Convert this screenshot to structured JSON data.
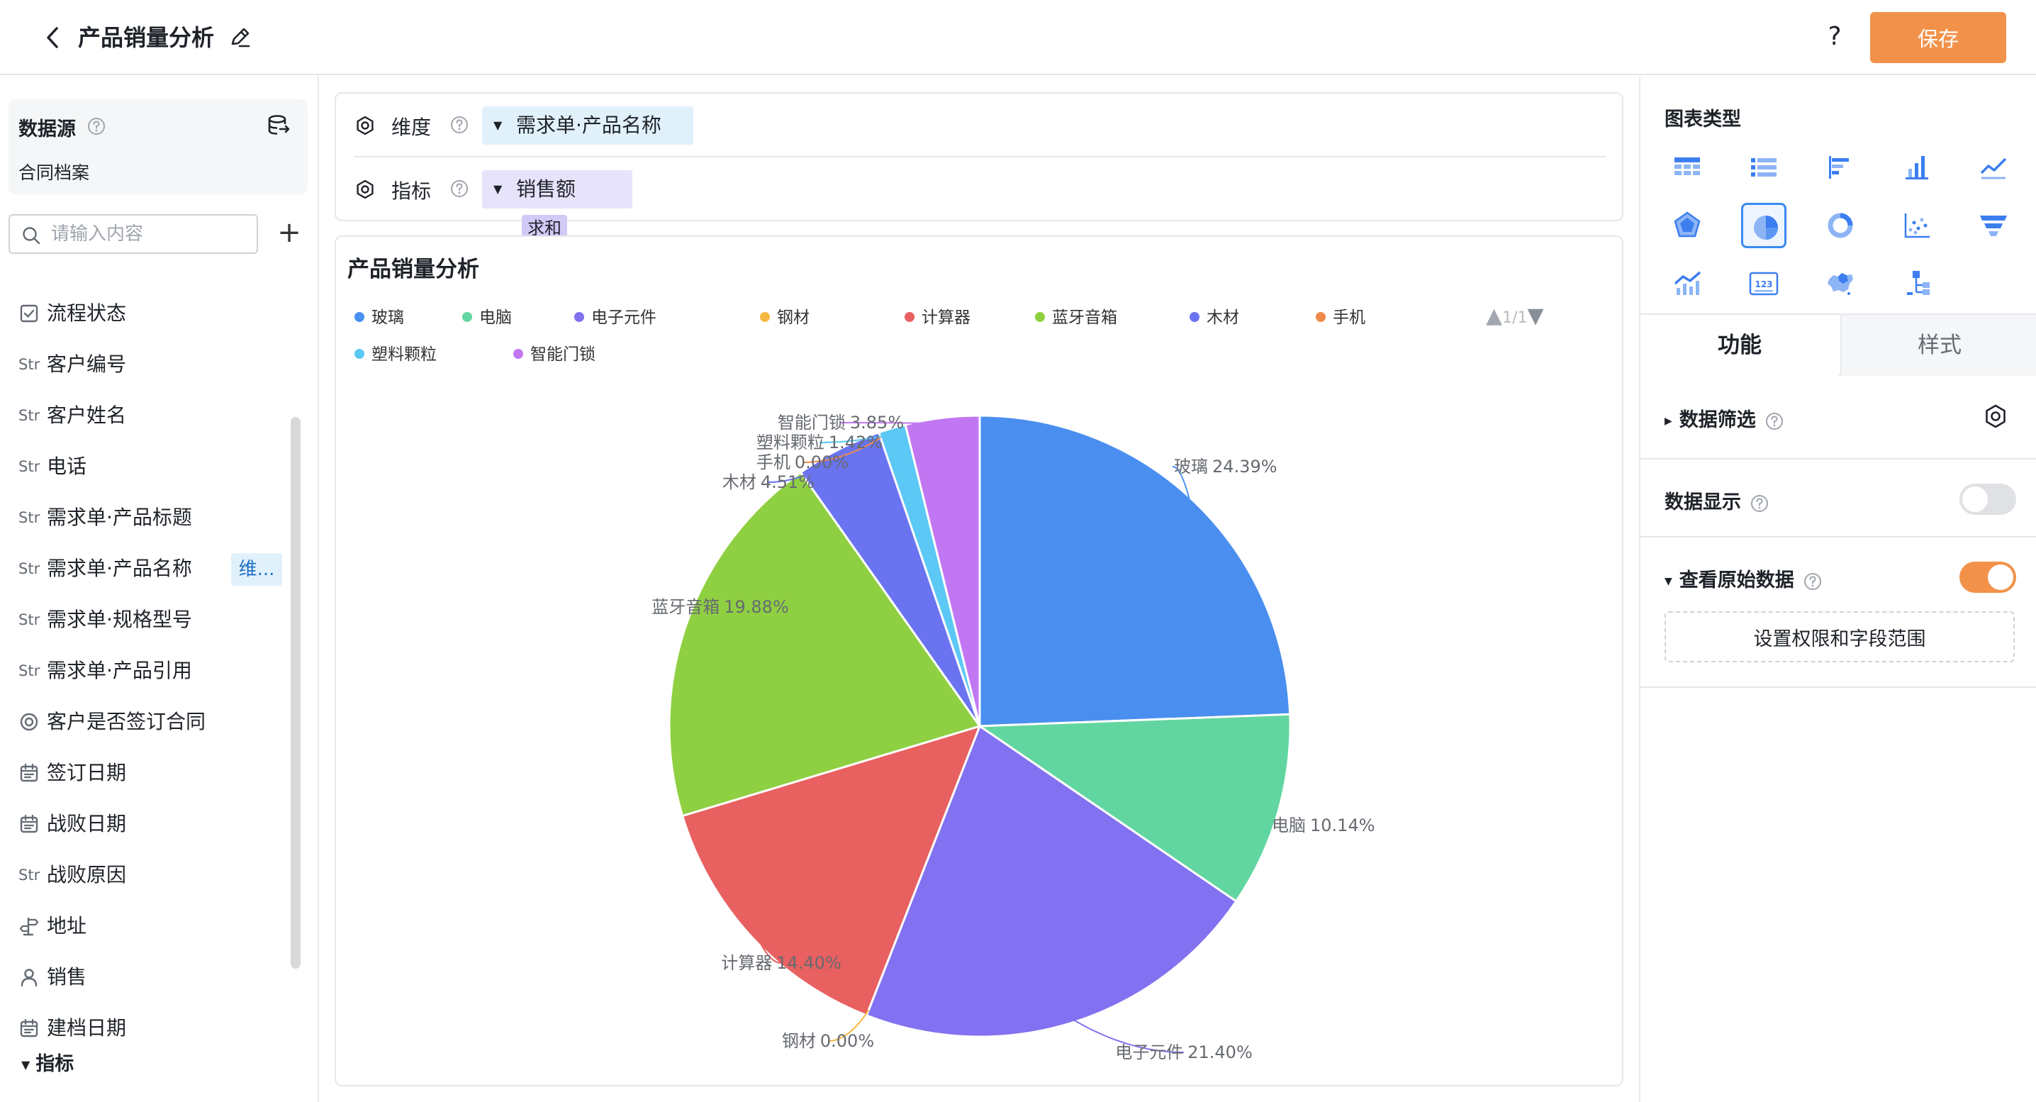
{
  "header": {
    "title": "产品销量分析",
    "help": "?",
    "save_label": "保存"
  },
  "datasource": {
    "label": "数据源",
    "name": "合同档案"
  },
  "search": {
    "placeholder": "请输入内容",
    "value": ""
  },
  "add": "+",
  "fields": [
    {
      "type": "check",
      "badge": "",
      "label": "流程状态"
    },
    {
      "type": "str",
      "badge": "Str",
      "label": "客户编号"
    },
    {
      "type": "str",
      "badge": "Str",
      "label": "客户姓名"
    },
    {
      "type": "str",
      "badge": "Str",
      "label": "电话"
    },
    {
      "type": "str",
      "badge": "Str",
      "label": "需求单·产品标题"
    },
    {
      "type": "str",
      "badge": "Str",
      "label": "需求单·产品名称",
      "tag": "维..."
    },
    {
      "type": "str",
      "badge": "Str",
      "label": "需求单·规格型号"
    },
    {
      "type": "str",
      "badge": "Str",
      "label": "需求单·产品引用"
    },
    {
      "type": "radio",
      "badge": "",
      "label": "客户是否签订合同"
    },
    {
      "type": "date",
      "badge": "",
      "label": "签订日期"
    },
    {
      "type": "date",
      "badge": "",
      "label": "战败日期"
    },
    {
      "type": "str",
      "badge": "Str",
      "label": "战败原因"
    },
    {
      "type": "address",
      "badge": "",
      "label": "地址"
    },
    {
      "type": "user",
      "badge": "",
      "label": "销售"
    },
    {
      "type": "date",
      "badge": "",
      "label": "建档日期"
    }
  ],
  "metrics_section": "指标",
  "config": {
    "dimension_label": "维度",
    "dimension_value": "需求单·产品名称",
    "measure_label": "指标",
    "measure_value": "销售额",
    "measure_agg": "求和"
  },
  "legend_pager": "1/1",
  "chart_data": {
    "type": "pie",
    "title": "产品销量分析",
    "legend_position": "top",
    "slices": [
      {
        "label": "玻璃",
        "percent": 24.39,
        "display": "24.39%",
        "color": "#4a8ff0"
      },
      {
        "label": "电脑",
        "percent": 10.14,
        "display": "10.14%",
        "color": "#62d6a0"
      },
      {
        "label": "电子元件",
        "percent": 21.4,
        "display": "21.40%",
        "color": "#8271f0"
      },
      {
        "label": "钢材",
        "percent": 0.0,
        "display": "0.00%",
        "color": "#f5b942"
      },
      {
        "label": "计算器",
        "percent": 14.4,
        "display": "14.40%",
        "color": "#e86060"
      },
      {
        "label": "蓝牙音箱",
        "percent": 19.88,
        "display": "19.88%",
        "color": "#8fd042"
      },
      {
        "label": "木材",
        "percent": 4.51,
        "display": "4.51%",
        "color": "#6a74f0"
      },
      {
        "label": "手机",
        "percent": 0.0,
        "display": "0.00%",
        "color": "#f08a4a"
      },
      {
        "label": "塑料颗粒",
        "percent": 1.42,
        "display": "1.42%",
        "color": "#5cc8f5"
      },
      {
        "label": "智能门锁",
        "percent": 3.85,
        "display": "3.85%",
        "color": "#c277f2"
      }
    ]
  },
  "right_panel": {
    "chart_type_label": "图表类型",
    "chart_types": [
      "table",
      "list",
      "bar-horizontal",
      "bar-vertical",
      "line",
      "radar",
      "pie",
      "donut",
      "scatter",
      "funnel",
      "combo",
      "kpi-number",
      "map",
      "tree"
    ],
    "selected_chart_type": "pie",
    "tab_function": "功能",
    "tab_style": "样式",
    "data_filter": "数据筛选",
    "data_display": "数据显示",
    "data_display_on": false,
    "view_raw": "查看原始数据",
    "view_raw_on": true,
    "permission_button": "设置权限和字段范围"
  },
  "colors": {
    "accent": "#f2924a",
    "selected": "#3c8af0"
  }
}
